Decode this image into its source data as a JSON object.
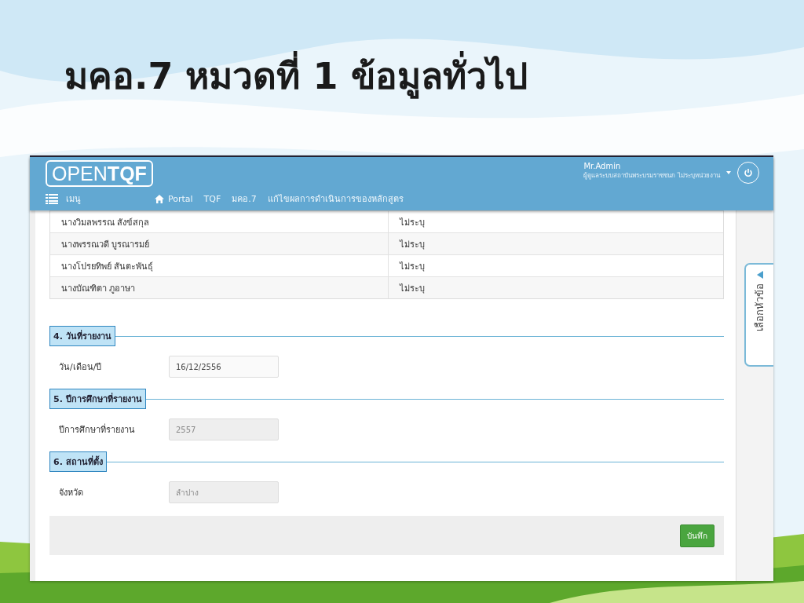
{
  "slide_title": "มคอ.7 หมวดที่ 1 ข้อมูลทั่วไป",
  "app": {
    "logo": "OPEN**TQF**",
    "menu_label": "เมนู",
    "breadcrumbs": [
      {
        "label": "Portal",
        "kind": "home"
      },
      {
        "label": "TQF",
        "kind": "plain"
      },
      {
        "label": "มคอ.7",
        "kind": "plain"
      },
      {
        "label": "แก้ไขผลการดำเนินการของหลักสูตร",
        "kind": "plain"
      }
    ],
    "user": {
      "name": "Mr.Admin",
      "role": "ผู้ดูแลระบบสถาบันพระบรมราชชนก ไม่ระบุหน่วยงาน"
    }
  },
  "table": {
    "rows": [
      {
        "name": "นางวิมลพรรณ สังข์สกุล",
        "column_2": "ไม่ระบุ"
      },
      {
        "name": "นางพรรณวดี บูรณารมย์",
        "column_2": "ไม่ระบุ"
      },
      {
        "name": "นางโปรยทิพย์ สันตะพันธุ์",
        "column_2": "ไม่ระบุ"
      },
      {
        "name": "นางบัณฑิตา ภูอาษา",
        "column_2": "ไม่ระบุ"
      }
    ]
  },
  "sections": [
    {
      "title": "4. วันที่รายงาน",
      "fields": [
        {
          "label": "วัน/เดือน/ปี",
          "value": "16/12/2556",
          "disabled": false
        }
      ]
    },
    {
      "title": "5. ปีการศึกษาที่รายงาน",
      "fields": [
        {
          "label": "ปีการศึกษาที่รายงาน",
          "value": "2557",
          "disabled": true
        }
      ]
    },
    {
      "title": "6. สถานที่ตั้ง",
      "fields": [
        {
          "label": "จังหวัด",
          "value": "ลำปาง",
          "disabled": true
        }
      ]
    }
  ],
  "save_button": "บันทึก",
  "side_tab": "เลือกหัวข้อ"
}
